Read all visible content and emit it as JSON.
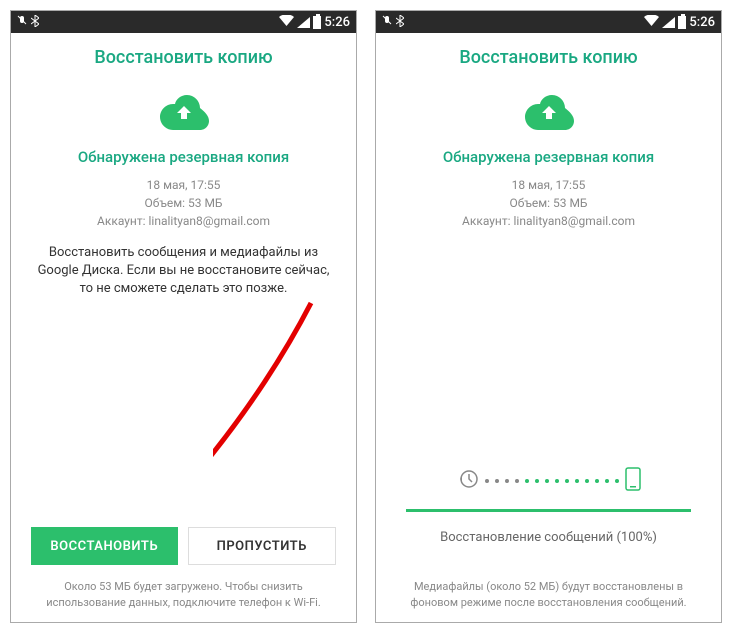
{
  "status_bar": {
    "time": "5:26"
  },
  "left_screen": {
    "title": "Восстановить копию",
    "subtitle": "Обнаружена резервная копия",
    "date": "18 мая, 17:55",
    "size": "Объем: 53 МБ",
    "account": "Аккаунт: linalityan8@gmail.com",
    "description": "Восстановить сообщения и медиафайлы из Google Диска. Если вы не восстановите сейчас, то не сможете сделать это позже.",
    "restore_button": "ВОССТАНОВИТЬ",
    "skip_button": "ПРОПУСТИТЬ",
    "footer": "Около 53 МБ будет загружено. Чтобы снизить использование данных, подключите телефон к Wi-Fi."
  },
  "right_screen": {
    "title": "Восстановить копию",
    "subtitle": "Обнаружена резервная копия",
    "date": "18 мая, 17:55",
    "size": "Объем: 53 МБ",
    "account": "Аккаунт: linalityan8@gmail.com",
    "progress_text": "Восстановление сообщений (100%)",
    "footer": "Медиафайлы (около 52 МБ) будут восстановлены в фоновом режиме после восстановления сообщений."
  }
}
